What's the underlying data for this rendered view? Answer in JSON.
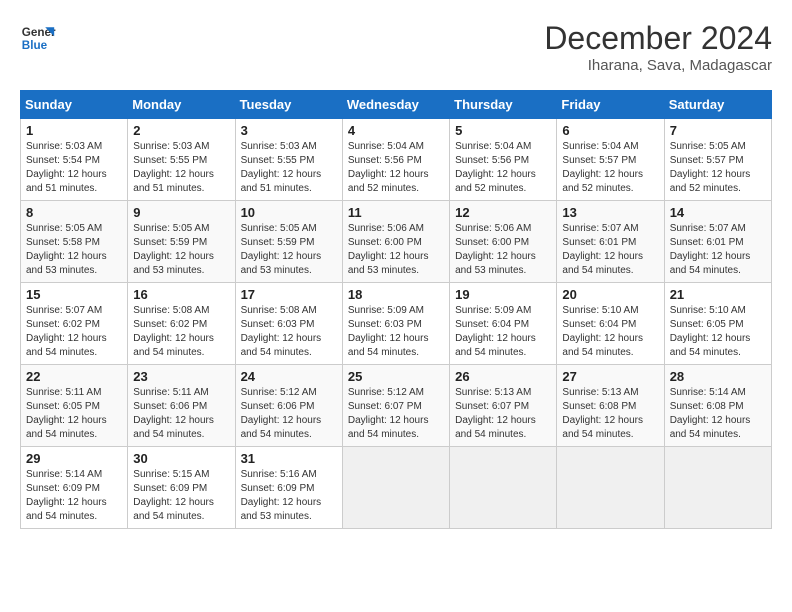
{
  "header": {
    "logo_line1": "General",
    "logo_line2": "Blue",
    "month": "December 2024",
    "location": "Iharana, Sava, Madagascar"
  },
  "days_of_week": [
    "Sunday",
    "Monday",
    "Tuesday",
    "Wednesday",
    "Thursday",
    "Friday",
    "Saturday"
  ],
  "weeks": [
    [
      {
        "day": "1",
        "info": "Sunrise: 5:03 AM\nSunset: 5:54 PM\nDaylight: 12 hours\nand 51 minutes."
      },
      {
        "day": "2",
        "info": "Sunrise: 5:03 AM\nSunset: 5:55 PM\nDaylight: 12 hours\nand 51 minutes."
      },
      {
        "day": "3",
        "info": "Sunrise: 5:03 AM\nSunset: 5:55 PM\nDaylight: 12 hours\nand 51 minutes."
      },
      {
        "day": "4",
        "info": "Sunrise: 5:04 AM\nSunset: 5:56 PM\nDaylight: 12 hours\nand 52 minutes."
      },
      {
        "day": "5",
        "info": "Sunrise: 5:04 AM\nSunset: 5:56 PM\nDaylight: 12 hours\nand 52 minutes."
      },
      {
        "day": "6",
        "info": "Sunrise: 5:04 AM\nSunset: 5:57 PM\nDaylight: 12 hours\nand 52 minutes."
      },
      {
        "day": "7",
        "info": "Sunrise: 5:05 AM\nSunset: 5:57 PM\nDaylight: 12 hours\nand 52 minutes."
      }
    ],
    [
      {
        "day": "8",
        "info": "Sunrise: 5:05 AM\nSunset: 5:58 PM\nDaylight: 12 hours\nand 53 minutes."
      },
      {
        "day": "9",
        "info": "Sunrise: 5:05 AM\nSunset: 5:59 PM\nDaylight: 12 hours\nand 53 minutes."
      },
      {
        "day": "10",
        "info": "Sunrise: 5:05 AM\nSunset: 5:59 PM\nDaylight: 12 hours\nand 53 minutes."
      },
      {
        "day": "11",
        "info": "Sunrise: 5:06 AM\nSunset: 6:00 PM\nDaylight: 12 hours\nand 53 minutes."
      },
      {
        "day": "12",
        "info": "Sunrise: 5:06 AM\nSunset: 6:00 PM\nDaylight: 12 hours\nand 53 minutes."
      },
      {
        "day": "13",
        "info": "Sunrise: 5:07 AM\nSunset: 6:01 PM\nDaylight: 12 hours\nand 54 minutes."
      },
      {
        "day": "14",
        "info": "Sunrise: 5:07 AM\nSunset: 6:01 PM\nDaylight: 12 hours\nand 54 minutes."
      }
    ],
    [
      {
        "day": "15",
        "info": "Sunrise: 5:07 AM\nSunset: 6:02 PM\nDaylight: 12 hours\nand 54 minutes."
      },
      {
        "day": "16",
        "info": "Sunrise: 5:08 AM\nSunset: 6:02 PM\nDaylight: 12 hours\nand 54 minutes."
      },
      {
        "day": "17",
        "info": "Sunrise: 5:08 AM\nSunset: 6:03 PM\nDaylight: 12 hours\nand 54 minutes."
      },
      {
        "day": "18",
        "info": "Sunrise: 5:09 AM\nSunset: 6:03 PM\nDaylight: 12 hours\nand 54 minutes."
      },
      {
        "day": "19",
        "info": "Sunrise: 5:09 AM\nSunset: 6:04 PM\nDaylight: 12 hours\nand 54 minutes."
      },
      {
        "day": "20",
        "info": "Sunrise: 5:10 AM\nSunset: 6:04 PM\nDaylight: 12 hours\nand 54 minutes."
      },
      {
        "day": "21",
        "info": "Sunrise: 5:10 AM\nSunset: 6:05 PM\nDaylight: 12 hours\nand 54 minutes."
      }
    ],
    [
      {
        "day": "22",
        "info": "Sunrise: 5:11 AM\nSunset: 6:05 PM\nDaylight: 12 hours\nand 54 minutes."
      },
      {
        "day": "23",
        "info": "Sunrise: 5:11 AM\nSunset: 6:06 PM\nDaylight: 12 hours\nand 54 minutes."
      },
      {
        "day": "24",
        "info": "Sunrise: 5:12 AM\nSunset: 6:06 PM\nDaylight: 12 hours\nand 54 minutes."
      },
      {
        "day": "25",
        "info": "Sunrise: 5:12 AM\nSunset: 6:07 PM\nDaylight: 12 hours\nand 54 minutes."
      },
      {
        "day": "26",
        "info": "Sunrise: 5:13 AM\nSunset: 6:07 PM\nDaylight: 12 hours\nand 54 minutes."
      },
      {
        "day": "27",
        "info": "Sunrise: 5:13 AM\nSunset: 6:08 PM\nDaylight: 12 hours\nand 54 minutes."
      },
      {
        "day": "28",
        "info": "Sunrise: 5:14 AM\nSunset: 6:08 PM\nDaylight: 12 hours\nand 54 minutes."
      }
    ],
    [
      {
        "day": "29",
        "info": "Sunrise: 5:14 AM\nSunset: 6:09 PM\nDaylight: 12 hours\nand 54 minutes."
      },
      {
        "day": "30",
        "info": "Sunrise: 5:15 AM\nSunset: 6:09 PM\nDaylight: 12 hours\nand 54 minutes."
      },
      {
        "day": "31",
        "info": "Sunrise: 5:16 AM\nSunset: 6:09 PM\nDaylight: 12 hours\nand 53 minutes."
      },
      {
        "day": "",
        "info": ""
      },
      {
        "day": "",
        "info": ""
      },
      {
        "day": "",
        "info": ""
      },
      {
        "day": "",
        "info": ""
      }
    ]
  ]
}
